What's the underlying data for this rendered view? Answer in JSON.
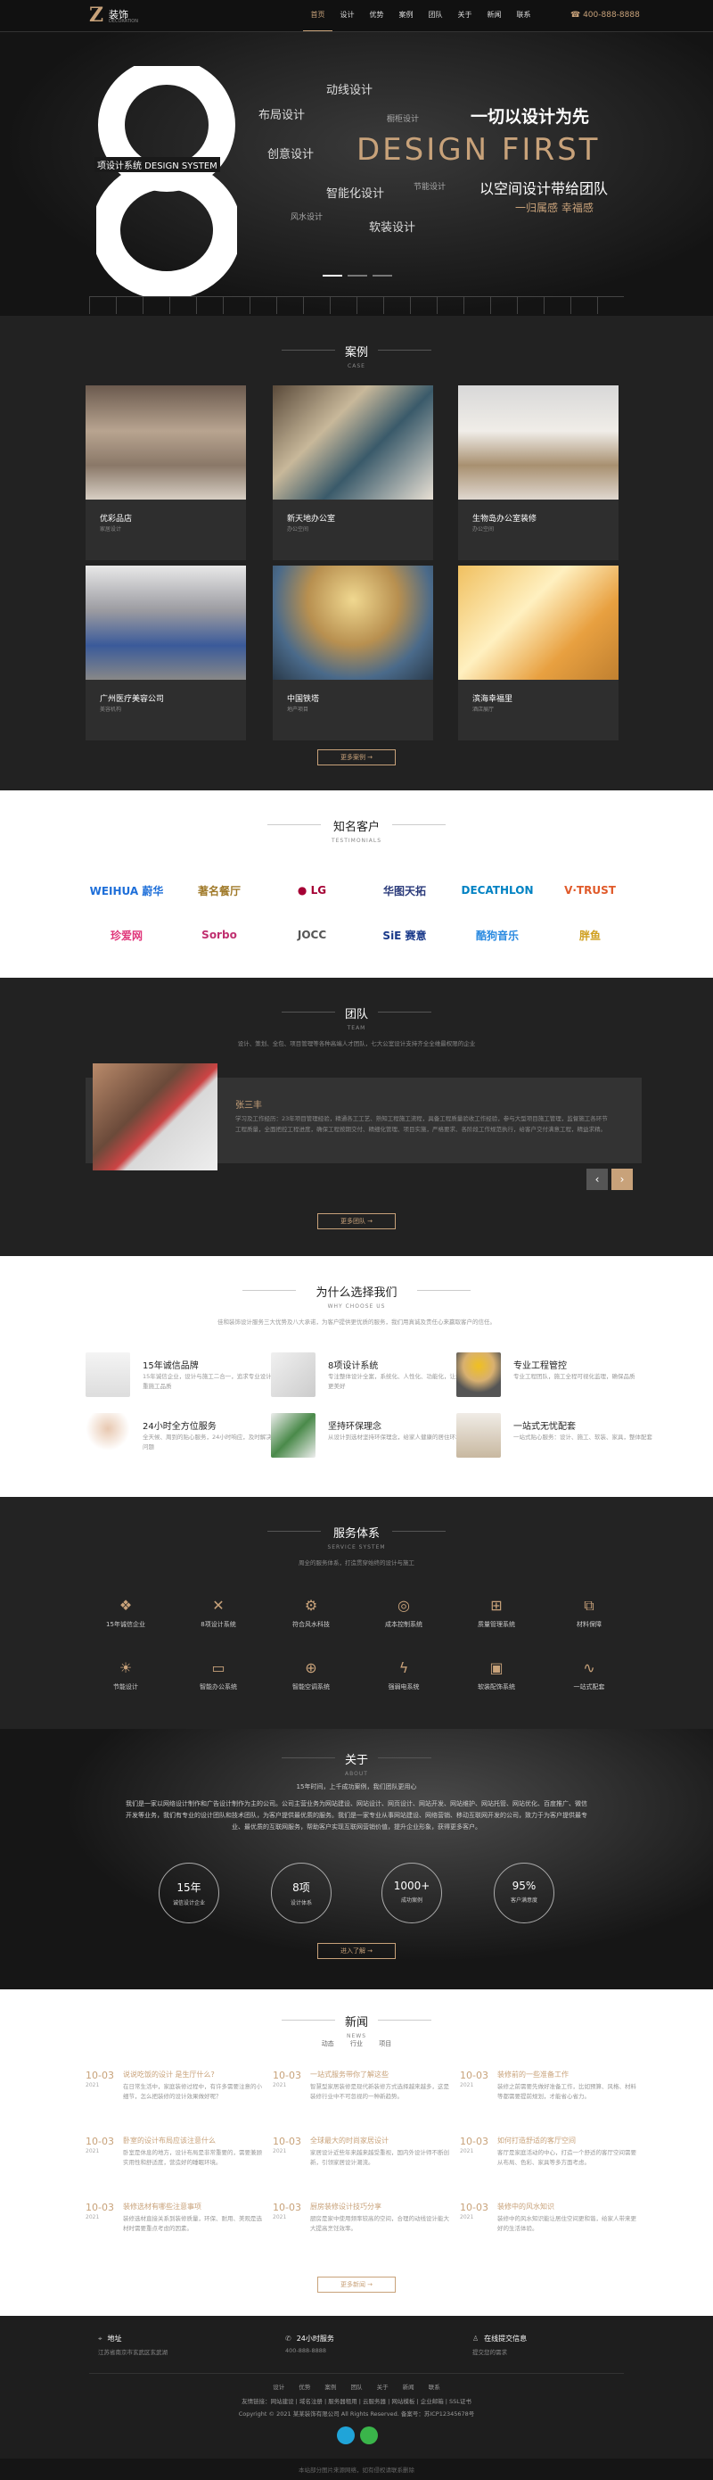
{
  "header": {
    "logo_letter": "Z",
    "logo_cn": "装饰",
    "logo_en": "DECORATION",
    "phone": "☎ 400-888-8888",
    "nav": [
      "首页",
      "设计",
      "优势",
      "案例",
      "团队",
      "关于",
      "新闻",
      "联系"
    ]
  },
  "hero": {
    "number": "8",
    "series_label": "项设计系统 DESIGN SYSTEM",
    "keywords": [
      "动线设计",
      "布局设计",
      "橱柜设计",
      "创意设计",
      "智能化设计",
      "节能设计",
      "风水设计",
      "软装设计"
    ],
    "slogan1": "一切以设计为先",
    "design_first": "DESIGN FIRST",
    "slogan2": "以空间设计带给团队",
    "slogan3": "一归属感 幸福感"
  },
  "cases": {
    "title": "案例",
    "en": "CASE",
    "more": "更多案例 →",
    "items": [
      {
        "name": "优彩品店",
        "sub": "家居设计"
      },
      {
        "name": "新天地办公室",
        "sub": "办公空间"
      },
      {
        "name": "生物岛办公室装修",
        "sub": "办公空间"
      },
      {
        "name": "广州医疗美容公司",
        "sub": "美容机构"
      },
      {
        "name": "中国铁塔",
        "sub": "地产项目"
      },
      {
        "name": "滨海幸福里",
        "sub": "酒店展厅"
      }
    ]
  },
  "clients": {
    "title": "知名客户",
    "en": "TESTIMONIALS",
    "logos": [
      {
        "text": "WEIHUA\n蔚华",
        "color": "#1e6fd9"
      },
      {
        "text": "著名餐厅",
        "color": "#a07a2a"
      },
      {
        "text": "● LG",
        "color": "#a50034"
      },
      {
        "text": "华图天拓",
        "color": "#2a3a7a"
      },
      {
        "text": "DECATHLON",
        "color": "#0082c3"
      },
      {
        "text": "V·TRUST",
        "color": "#e05a2a"
      },
      {
        "text": "珍爱网",
        "color": "#e0357a"
      },
      {
        "text": "Sorbo",
        "color": "#c03070"
      },
      {
        "text": "JOCC",
        "color": "#555"
      },
      {
        "text": "SiE 赛意",
        "color": "#1a3a8a"
      },
      {
        "text": "酷狗音乐",
        "color": "#2a8ae0"
      },
      {
        "text": "胖鱼",
        "color": "#d0a020"
      }
    ]
  },
  "team": {
    "title": "团队",
    "en": "TEAM",
    "intro": "设计、策划、全包、项目管理等各种高端人才团队，七大公室设计支持齐全全维最权限的企业",
    "name": "张三丰",
    "desc": "学习及工作经历：23年项目管理经验，精通各工工艺、熟知工程施工流程，具备工程质量验收工作经验，参与大型项目施工管理，监督施工各环节工程质量，全面把控工程进度，确保工程按期交付、精细化管理、项目实施，严格要求、各阶段工作规范执行，给客户交付满意工程，精益求精。",
    "more": "更多团队 →"
  },
  "why": {
    "title": "为什么选择我们",
    "en": "WHY CHOOSE US",
    "intro": "佳和装饰设计服务三大优势及八大承诺，为客户提供更优质的服务，我们用真诚及责任心来赢取客户的信任。",
    "items": [
      {
        "t": "15年诚信品牌",
        "d": "15年诚信企业，设计与施工二合一，追求专业设计，注重施工品质"
      },
      {
        "t": "8项设计系统",
        "d": "专注整体设计全案，系统化、人性化、功能化，让生活更美好"
      },
      {
        "t": "专业工程管控",
        "d": "专业工程团队，施工全程可视化监理，确保品质"
      },
      {
        "t": "24小时全方位服务",
        "d": "全天候、周到的贴心服务，24小时响应，及时解决客户问题"
      },
      {
        "t": "坚持环保理念",
        "d": "从设计到选材坚持环保理念，给家人健康的居住环境"
      },
      {
        "t": "一站式无忧配套",
        "d": "一站式贴心服务：设计、施工、软装、家具，整体配套"
      }
    ]
  },
  "service": {
    "title": "服务体系",
    "en": "SERVICE SYSTEM",
    "intro": "周全的服务体系，打造贯穿始终的设计与施工",
    "items": [
      {
        "i": "❖",
        "t": "15年诚信企业"
      },
      {
        "i": "✕",
        "t": "8项设计系统"
      },
      {
        "i": "⚙",
        "t": "符合风水科技"
      },
      {
        "i": "◎",
        "t": "成本控制系统"
      },
      {
        "i": "⊞",
        "t": "质量管理系统"
      },
      {
        "i": "⧉",
        "t": "材料保障"
      },
      {
        "i": "☀",
        "t": "节能设计"
      },
      {
        "i": "▭",
        "t": "智能办公系统"
      },
      {
        "i": "⊕",
        "t": "智能空调系统"
      },
      {
        "i": "ϟ",
        "t": "强弱电系统"
      },
      {
        "i": "▣",
        "t": "软装配饰系统"
      },
      {
        "i": "∿",
        "t": "一站式配套"
      }
    ]
  },
  "about": {
    "title": "关于",
    "en": "ABOUT",
    "lead": "15年时间，上千成功案例，我们团队更用心",
    "text": "我们是一家以网络设计制作和广告设计制作为主的公司。公司主营业务为网站建设、网站设计、网页设计、网站开发、网站维护、网站托管、网站优化、百度推广、微信开发等业务，我们有专业的设计团队和技术团队，为客户提供最优质的服务。我们是一家专业从事网站建设、网络营销、移动互联网开发的公司，致力于为客户提供最专业、最优质的互联网服务，帮助客户实现互联网营销价值，提升企业形象，获得更多客户。",
    "stats": [
      {
        "v": "15年",
        "l": "诚信设计企业"
      },
      {
        "v": "8项",
        "l": "设计体系"
      },
      {
        "v": "1000+",
        "l": "成功案例"
      },
      {
        "v": "95%",
        "l": "客户满意度"
      }
    ],
    "more": "进入了解 →"
  },
  "news": {
    "title": "新闻",
    "en": "NEWS",
    "tabs": [
      "动态",
      "行业",
      "项目"
    ],
    "more": "更多新闻 →",
    "items": [
      {
        "d": "10-03",
        "y": "2021",
        "t": "说说吃饭的设计 是生厅什么?",
        "d2": "在日常生活中，家庭装修过程中，有许多需要注意的小细节，怎么把装修的设计效果做好呢？"
      },
      {
        "d": "10-03",
        "y": "2021",
        "t": "一站式服务带你了解这些",
        "d2": "智慧型家居装修是现代新装修方式选择越来越多，这是装修行业中不可忽视的一种新趋势。"
      },
      {
        "d": "10-03",
        "y": "2021",
        "t": "装修前的一些准备工作",
        "d2": "装修之前需要先做好准备工作，比如预算、风格、材料等都需要提前规划，才能省心省力。"
      },
      {
        "d": "10-03",
        "y": "2021",
        "t": "卧室的设计布局应该注意什么",
        "d2": "卧室是休息的地方，设计布局是非常重要的，需要兼顾实用性和舒适度，营造好的睡眠环境。"
      },
      {
        "d": "10-03",
        "y": "2021",
        "t": "全球最大的时尚家居设计",
        "d2": "家居设计近些年来越来越受重视，国内外设计师不断创新，引领家居设计潮流。"
      },
      {
        "d": "10-03",
        "y": "2021",
        "t": "如何打造舒适的客厅空间",
        "d2": "客厅是家庭活动的中心，打造一个舒适的客厅空间需要从布局、色彩、家具等多方面考虑。"
      },
      {
        "d": "10-03",
        "y": "2021",
        "t": "装修选材有哪些注意事项",
        "d2": "装修选材直接关系到装修质量，环保、耐用、美观是选材时需要重点考虑的因素。"
      },
      {
        "d": "10-03",
        "y": "2021",
        "t": "厨房装修设计技巧分享",
        "d2": "厨房是家中使用频率较高的空间，合理的动线设计能大大提高烹饪效率。"
      },
      {
        "d": "10-03",
        "y": "2021",
        "t": "装修中的风水知识",
        "d2": "装修中的风水知识能让居住空间更和谐，给家人带来更好的生活体验。"
      }
    ]
  },
  "footer": {
    "contacts": [
      {
        "t": "地址",
        "s": "江苏省南京市玄武区玄武湖"
      },
      {
        "t": "24小时服务",
        "s": "400-888-8888"
      },
      {
        "t": "在线提交信息",
        "s": "提交您的需求"
      }
    ],
    "links": [
      "设计",
      "优势",
      "案例",
      "团队",
      "关于",
      "新闻",
      "联系"
    ],
    "partners": "友情链接：网站建设 | 域名注册 | 服务器租用 | 云服务器 | 网站模板 | 企业邮箱 | SSL证书",
    "copyright": "Copyright © 2021 某某装饰有限公司 All Rights Reserved. 备案号：苏ICP12345678号",
    "bottom": "本站部分图片来源网络，如有侵权请联系删除"
  }
}
